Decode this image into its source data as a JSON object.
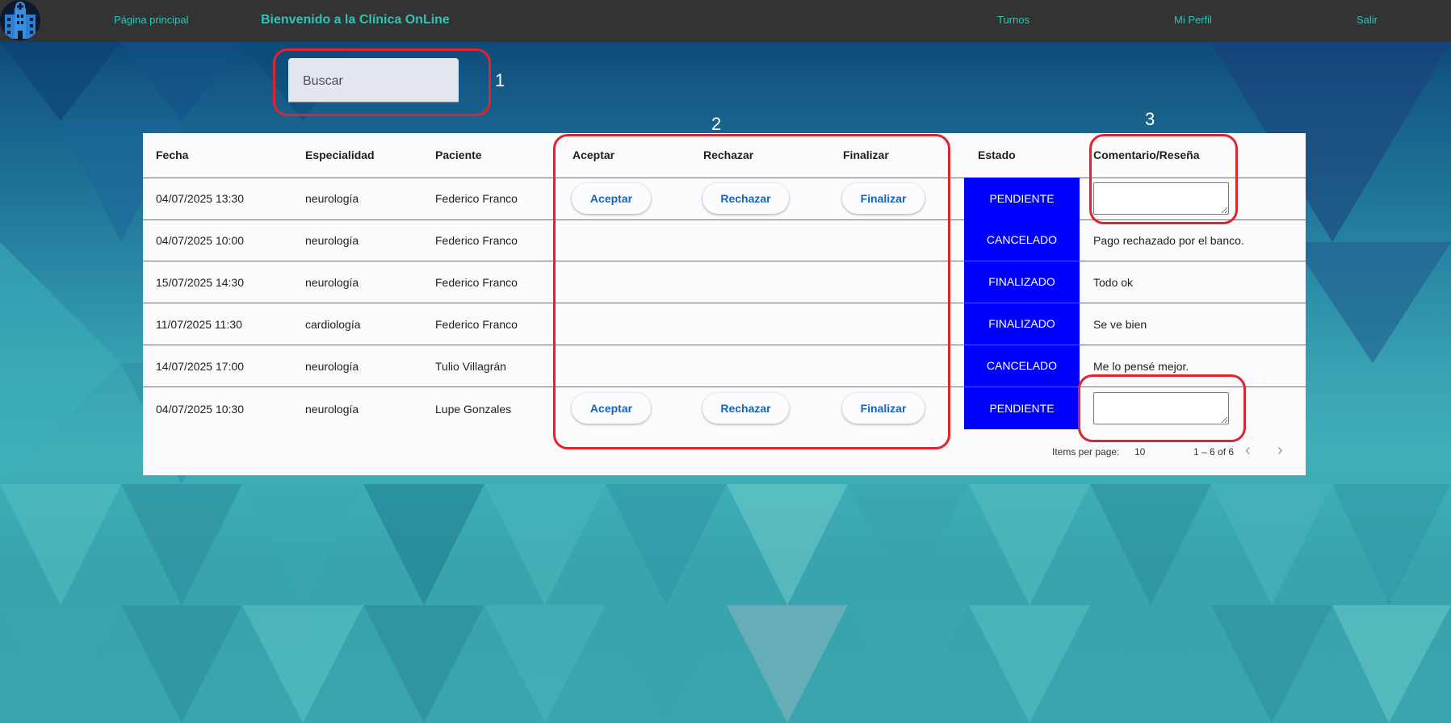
{
  "nav": {
    "home": "Página principal",
    "title": "Bienvenido a la Clínica OnLine",
    "turnos": "Turnos",
    "perfil": "Mi Perfil",
    "salir": "Salir"
  },
  "search": {
    "placeholder": "Buscar"
  },
  "annotations": [
    "1",
    "2",
    "3",
    "3"
  ],
  "table": {
    "headers": {
      "fecha": "Fecha",
      "especialidad": "Especialidad",
      "paciente": "Paciente",
      "aceptar": "Aceptar",
      "rechazar": "Rechazar",
      "finalizar": "Finalizar",
      "estado": "Estado",
      "comentario": "Comentario/Reseña"
    },
    "rows": [
      {
        "fecha": "04/07/2025 13:30",
        "especialidad": "neurología",
        "paciente": "Federico Franco",
        "aceptar": "Aceptar",
        "rechazar": "Rechazar",
        "finalizar": "Finalizar",
        "estado": "PENDIENTE",
        "comentario": ""
      },
      {
        "fecha": "04/07/2025 10:00",
        "especialidad": "neurología",
        "paciente": "Federico Franco",
        "estado": "CANCELADO",
        "comentario": "Pago rechazado por el banco."
      },
      {
        "fecha": "15/07/2025 14:30",
        "especialidad": "neurología",
        "paciente": "Federico Franco",
        "estado": "FINALIZADO",
        "comentario": "Todo ok"
      },
      {
        "fecha": "11/07/2025 11:30",
        "especialidad": "cardiología",
        "paciente": "Federico Franco",
        "estado": "FINALIZADO",
        "comentario": "Se ve bien"
      },
      {
        "fecha": "14/07/2025 17:00",
        "especialidad": "neurología",
        "paciente": "Tulio Villagrán",
        "estado": "CANCELADO",
        "comentario": "Me lo pensé mejor."
      },
      {
        "fecha": "04/07/2025 10:30",
        "especialidad": "neurología",
        "paciente": "Lupe Gonzales",
        "aceptar": "Aceptar",
        "rechazar": "Rechazar",
        "finalizar": "Finalizar",
        "estado": "PENDIENTE",
        "comentario": ""
      }
    ]
  },
  "paginator": {
    "items_label": "Items per page:",
    "page_size": "10",
    "range": "1 – 6 of 6",
    "prev_icon": "chevron-left-icon",
    "next_icon": "chevron-right-icon"
  },
  "colors": {
    "navbar": "#333333",
    "nav_text": "#2ec4b6",
    "estado_bg": "#0000ff",
    "button_text": "#1565c0",
    "annotation": "#e0232d"
  }
}
